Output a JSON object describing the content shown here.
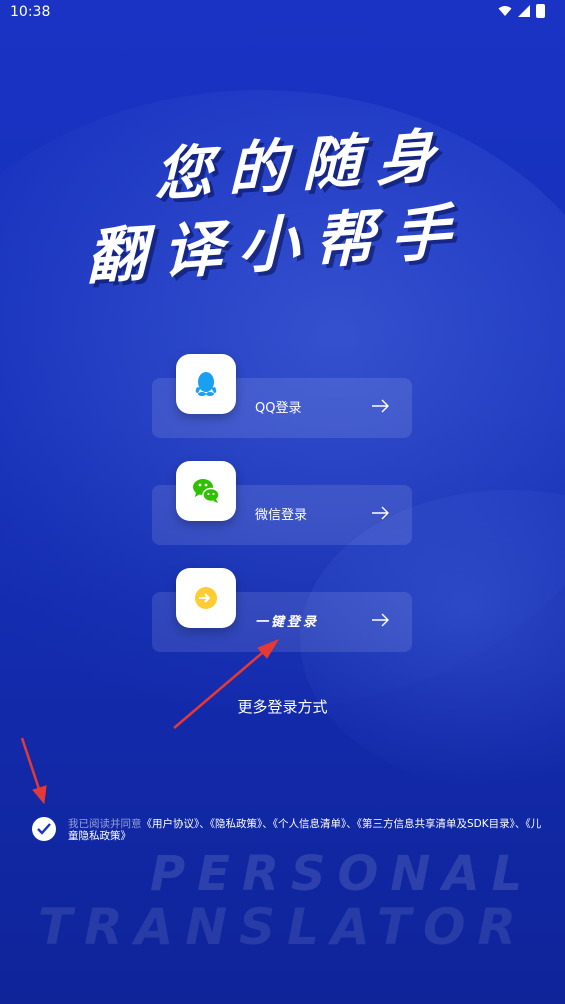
{
  "status_bar": {
    "time": "10:38"
  },
  "slogan": {
    "line1": "您的随身",
    "line2": "翻译小帮手"
  },
  "login": {
    "qq_label": "QQ登录",
    "wechat_label": "微信登录",
    "one_click_label": "一键登录"
  },
  "more_login": "更多登录方式",
  "agreement": {
    "prefix": "我已阅读并同意",
    "text": "《用户协议》、《隐私政策》、《个人信息清单》、《第三方信息共享清单及SDK目录》、《儿童隐私政策》"
  },
  "watermark": {
    "line1": "PERSONAL",
    "line2": "TRANSLATOR"
  },
  "colors": {
    "background": "#1a33c4",
    "qq_blue": "#1aa0f2",
    "wechat_green": "#2dc100",
    "one_click_yellow": "#ffcc33",
    "annotation_red": "#e53935"
  }
}
